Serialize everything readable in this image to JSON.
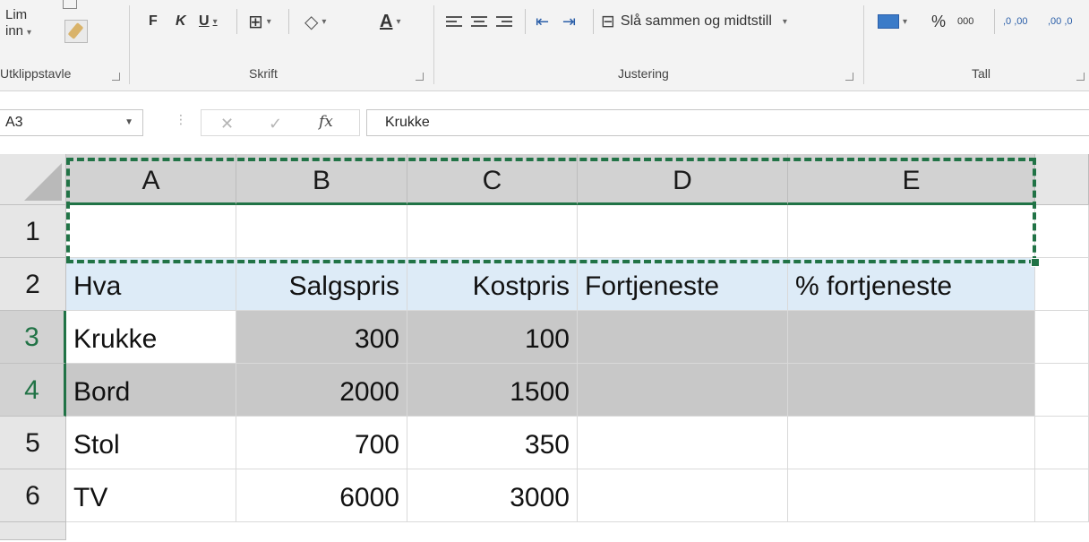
{
  "ribbon": {
    "paste_label_line1": "Lim",
    "paste_label_line2": "inn",
    "bold": "F",
    "italic": "K",
    "underline": "U",
    "font_color_letter": "A",
    "merge_center": "Slå sammen og midtstill",
    "percent": "%",
    "thousands": "000",
    "increase_decimal": ",0 ,00",
    "decrease_decimal": ",00 ,0",
    "groups": {
      "clipboard": "Utklippstavle",
      "font": "Skrift",
      "alignment": "Justering",
      "number": "Tall"
    }
  },
  "formula_bar": {
    "name_box": "A3",
    "fx": "fx",
    "content": "Krukke"
  },
  "grid": {
    "columns": [
      "A",
      "B",
      "C",
      "D",
      "E"
    ],
    "rows": [
      {
        "number": "1",
        "cells": [
          "",
          "",
          "",
          "",
          ""
        ]
      },
      {
        "number": "2",
        "cells": [
          "Hva",
          "Salgspris",
          "Kostpris",
          "Fortjeneste",
          "% fortjeneste"
        ]
      },
      {
        "number": "3",
        "cells": [
          "Krukke",
          "300",
          "100",
          "",
          ""
        ]
      },
      {
        "number": "4",
        "cells": [
          "Bord",
          "2000",
          "1500",
          "",
          ""
        ]
      },
      {
        "number": "5",
        "cells": [
          "Stol",
          "700",
          "350",
          "",
          ""
        ]
      },
      {
        "number": "6",
        "cells": [
          "TV",
          "6000",
          "3000",
          "",
          ""
        ]
      }
    ],
    "selected_range": "A3:E4",
    "active_cell": "A3"
  },
  "colors": {
    "accent": "#217346",
    "header_row_fill": "#ddebf7",
    "selection_fill": "#c8c8c8",
    "font_color_bar": "#e01a1a"
  }
}
